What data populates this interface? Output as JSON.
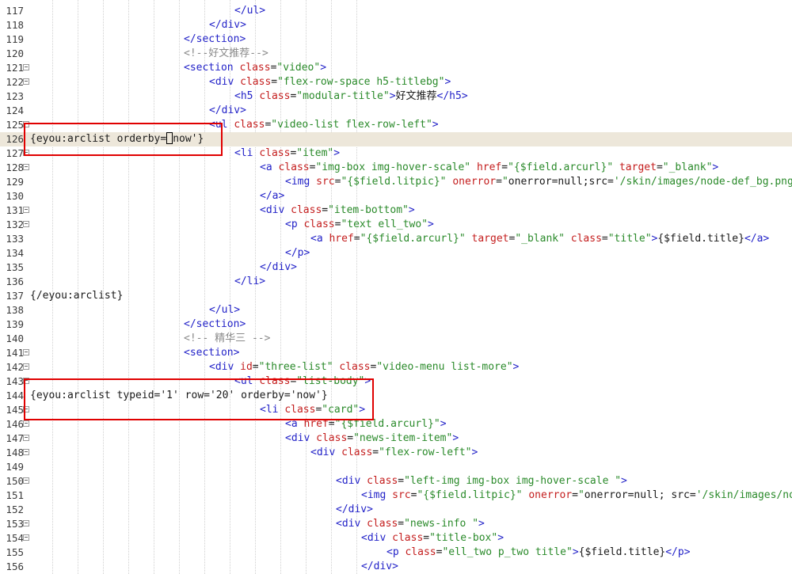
{
  "editor": {
    "guide_columns": [
      66,
      98,
      130,
      162,
      194,
      226,
      258,
      290,
      322,
      354,
      386,
      418,
      450
    ],
    "highlight_boxes": [
      {
        "label": "orderby-now-box"
      },
      {
        "label": "typeid-row-box"
      }
    ],
    "lines": [
      {
        "no": "117",
        "fold": false,
        "indent": 8,
        "tokens": [
          [
            "t",
            "</ul>"
          ]
        ]
      },
      {
        "no": "118",
        "fold": false,
        "indent": 7,
        "tokens": [
          [
            "t",
            "</div>"
          ]
        ]
      },
      {
        "no": "119",
        "fold": false,
        "indent": 6,
        "tokens": [
          [
            "t",
            "</section>"
          ]
        ]
      },
      {
        "no": "120",
        "fold": false,
        "indent": 6,
        "tokens": [
          [
            "c",
            "<!--好文推荐-->"
          ]
        ]
      },
      {
        "no": "121",
        "fold": true,
        "indent": 6,
        "tokens": [
          [
            "t",
            "<section "
          ],
          [
            "a",
            "class"
          ],
          [
            "x",
            "="
          ],
          [
            "s",
            "\"video\""
          ],
          [
            "t",
            ">"
          ]
        ]
      },
      {
        "no": "122",
        "fold": true,
        "indent": 7,
        "tokens": [
          [
            "t",
            "<div "
          ],
          [
            "a",
            "class"
          ],
          [
            "x",
            "="
          ],
          [
            "s",
            "\"flex-row-space h5-titlebg\""
          ],
          [
            "t",
            ">"
          ]
        ]
      },
      {
        "no": "123",
        "fold": false,
        "indent": 8,
        "tokens": [
          [
            "t",
            "<h5 "
          ],
          [
            "a",
            "class"
          ],
          [
            "x",
            "="
          ],
          [
            "s",
            "\"modular-title\""
          ],
          [
            "t",
            ">"
          ],
          [
            "x",
            "好文推荐"
          ],
          [
            "t",
            "</h5>"
          ]
        ]
      },
      {
        "no": "124",
        "fold": false,
        "indent": 7,
        "tokens": [
          [
            "t",
            "</div>"
          ]
        ]
      },
      {
        "no": "125",
        "fold": true,
        "indent": 7,
        "tokens": [
          [
            "t",
            "<ul "
          ],
          [
            "a",
            "class"
          ],
          [
            "x",
            "="
          ],
          [
            "s",
            "\"video-list flex-row-left\""
          ],
          [
            "t",
            ">"
          ]
        ]
      },
      {
        "no": "126",
        "fold": false,
        "indent": 0,
        "current": true,
        "tokens": [
          [
            "x",
            "{eyou:arclist orderby="
          ],
          [
            "caret",
            ""
          ],
          [
            "x",
            "now'}"
          ]
        ]
      },
      {
        "no": "127",
        "fold": true,
        "indent": 8,
        "tokens": [
          [
            "t",
            "<li "
          ],
          [
            "a",
            "class"
          ],
          [
            "x",
            "="
          ],
          [
            "s",
            "\"item\""
          ],
          [
            "t",
            ">"
          ]
        ]
      },
      {
        "no": "128",
        "fold": true,
        "indent": 9,
        "tokens": [
          [
            "t",
            "<a "
          ],
          [
            "a",
            "class"
          ],
          [
            "x",
            "="
          ],
          [
            "s",
            "\"img-box img-hover-scale\""
          ],
          [
            "x",
            " "
          ],
          [
            "a",
            "href"
          ],
          [
            "x",
            "="
          ],
          [
            "s",
            "\"{$field.arcurl}\""
          ],
          [
            "x",
            " "
          ],
          [
            "a",
            "target"
          ],
          [
            "x",
            "="
          ],
          [
            "s",
            "\"_blank\""
          ],
          [
            "t",
            ">"
          ]
        ]
      },
      {
        "no": "129",
        "fold": false,
        "indent": 10,
        "tokens": [
          [
            "t",
            "<img "
          ],
          [
            "a",
            "src"
          ],
          [
            "x",
            "="
          ],
          [
            "s",
            "\"{$field.litpic}\""
          ],
          [
            "x",
            " "
          ],
          [
            "a",
            "onerror"
          ],
          [
            "x",
            "="
          ],
          [
            "s",
            "\""
          ],
          [
            "x",
            "onerror=null;src="
          ],
          [
            "s",
            "'/skin/images/node-def_bg.png"
          ]
        ]
      },
      {
        "no": "130",
        "fold": false,
        "indent": 9,
        "tokens": [
          [
            "t",
            "</a>"
          ]
        ]
      },
      {
        "no": "131",
        "fold": true,
        "indent": 9,
        "tokens": [
          [
            "t",
            "<div "
          ],
          [
            "a",
            "class"
          ],
          [
            "x",
            "="
          ],
          [
            "s",
            "\"item-bottom\""
          ],
          [
            "t",
            ">"
          ]
        ]
      },
      {
        "no": "132",
        "fold": true,
        "indent": 10,
        "tokens": [
          [
            "t",
            "<p "
          ],
          [
            "a",
            "class"
          ],
          [
            "x",
            "="
          ],
          [
            "s",
            "\"text ell_two\""
          ],
          [
            "t",
            ">"
          ]
        ]
      },
      {
        "no": "133",
        "fold": false,
        "indent": 11,
        "tokens": [
          [
            "t",
            "<a "
          ],
          [
            "a",
            "href"
          ],
          [
            "x",
            "="
          ],
          [
            "s",
            "\"{$field.arcurl}\""
          ],
          [
            "x",
            " "
          ],
          [
            "a",
            "target"
          ],
          [
            "x",
            "="
          ],
          [
            "s",
            "\"_blank\""
          ],
          [
            "x",
            " "
          ],
          [
            "a",
            "class"
          ],
          [
            "x",
            "="
          ],
          [
            "s",
            "\"title\""
          ],
          [
            "t",
            ">"
          ],
          [
            "x",
            "{$field.title}"
          ],
          [
            "t",
            "</a>"
          ]
        ]
      },
      {
        "no": "134",
        "fold": false,
        "indent": 10,
        "tokens": [
          [
            "t",
            "</p>"
          ]
        ]
      },
      {
        "no": "135",
        "fold": false,
        "indent": 9,
        "tokens": [
          [
            "t",
            "</div>"
          ]
        ]
      },
      {
        "no": "136",
        "fold": false,
        "indent": 8,
        "tokens": [
          [
            "t",
            "</li>"
          ]
        ]
      },
      {
        "no": "137",
        "fold": false,
        "indent": 0,
        "tokens": [
          [
            "x",
            "{/eyou:arclist}"
          ]
        ]
      },
      {
        "no": "138",
        "fold": false,
        "indent": 7,
        "tokens": [
          [
            "t",
            "</ul>"
          ]
        ]
      },
      {
        "no": "139",
        "fold": false,
        "indent": 6,
        "tokens": [
          [
            "t",
            "</section>"
          ]
        ]
      },
      {
        "no": "140",
        "fold": false,
        "indent": 6,
        "tokens": [
          [
            "c",
            "<!-- 精华三 -->"
          ]
        ]
      },
      {
        "no": "141",
        "fold": true,
        "indent": 6,
        "tokens": [
          [
            "t",
            "<section>"
          ]
        ]
      },
      {
        "no": "142",
        "fold": true,
        "indent": 7,
        "tokens": [
          [
            "t",
            "<div "
          ],
          [
            "a",
            "id"
          ],
          [
            "x",
            "="
          ],
          [
            "s",
            "\"three-list\""
          ],
          [
            "x",
            " "
          ],
          [
            "a",
            "class"
          ],
          [
            "x",
            "="
          ],
          [
            "s",
            "\"video-menu list-more\""
          ],
          [
            "t",
            ">"
          ]
        ]
      },
      {
        "no": "143",
        "fold": true,
        "indent": 8,
        "tokens": [
          [
            "t",
            "<ul "
          ],
          [
            "a",
            "class"
          ],
          [
            "x",
            "="
          ],
          [
            "s",
            "\"list-body\""
          ],
          [
            "t",
            ">"
          ]
        ]
      },
      {
        "no": "144",
        "fold": false,
        "indent": 0,
        "tokens": [
          [
            "x",
            "{eyou:arclist typeid='1' row='20' orderby='now'}"
          ]
        ]
      },
      {
        "no": "145",
        "fold": true,
        "indent": 9,
        "tokens": [
          [
            "t",
            "<li "
          ],
          [
            "a",
            "class"
          ],
          [
            "x",
            "="
          ],
          [
            "s",
            "\"card\""
          ],
          [
            "t",
            ">"
          ]
        ]
      },
      {
        "no": "146",
        "fold": true,
        "indent": 10,
        "tokens": [
          [
            "t",
            "<a "
          ],
          [
            "a",
            "href"
          ],
          [
            "x",
            "="
          ],
          [
            "s",
            "\"{$field.arcurl}\""
          ],
          [
            "t",
            ">"
          ]
        ]
      },
      {
        "no": "147",
        "fold": true,
        "indent": 10,
        "tokens": [
          [
            "t",
            "<div "
          ],
          [
            "a",
            "class"
          ],
          [
            "x",
            "="
          ],
          [
            "s",
            "\"news-item-item\""
          ],
          [
            "t",
            ">"
          ]
        ]
      },
      {
        "no": "148",
        "fold": true,
        "indent": 11,
        "tokens": [
          [
            "t",
            "<div "
          ],
          [
            "a",
            "class"
          ],
          [
            "x",
            "="
          ],
          [
            "s",
            "\"flex-row-left\""
          ],
          [
            "t",
            ">"
          ]
        ]
      },
      {
        "no": "149",
        "fold": false,
        "indent": 0,
        "tokens": []
      },
      {
        "no": "150",
        "fold": true,
        "indent": 12,
        "tokens": [
          [
            "t",
            "<div "
          ],
          [
            "a",
            "class"
          ],
          [
            "x",
            "="
          ],
          [
            "s",
            "\"left-img img-box img-hover-scale \""
          ],
          [
            "t",
            ">"
          ]
        ]
      },
      {
        "no": "151",
        "fold": false,
        "indent": 13,
        "tokens": [
          [
            "t",
            "<img "
          ],
          [
            "a",
            "src"
          ],
          [
            "x",
            "="
          ],
          [
            "s",
            "\"{$field.litpic}\""
          ],
          [
            "x",
            " "
          ],
          [
            "a",
            "onerror"
          ],
          [
            "x",
            "="
          ],
          [
            "s",
            "\""
          ],
          [
            "x",
            "onerror=null; src="
          ],
          [
            "s",
            "'/skin/images/nod"
          ]
        ]
      },
      {
        "no": "152",
        "fold": false,
        "indent": 12,
        "tokens": [
          [
            "t",
            "</div>"
          ]
        ]
      },
      {
        "no": "153",
        "fold": true,
        "indent": 12,
        "tokens": [
          [
            "t",
            "<div "
          ],
          [
            "a",
            "class"
          ],
          [
            "x",
            "="
          ],
          [
            "s",
            "\"news-info \""
          ],
          [
            "t",
            ">"
          ]
        ]
      },
      {
        "no": "154",
        "fold": true,
        "indent": 13,
        "tokens": [
          [
            "t",
            "<div "
          ],
          [
            "a",
            "class"
          ],
          [
            "x",
            "="
          ],
          [
            "s",
            "\"title-box\""
          ],
          [
            "t",
            ">"
          ]
        ]
      },
      {
        "no": "155",
        "fold": false,
        "indent": 14,
        "tokens": [
          [
            "t",
            "<p "
          ],
          [
            "a",
            "class"
          ],
          [
            "x",
            "="
          ],
          [
            "s",
            "\"ell_two p_two title\""
          ],
          [
            "t",
            ">"
          ],
          [
            "x",
            "{$field.title}"
          ],
          [
            "t",
            "</p>"
          ]
        ]
      },
      {
        "no": "156",
        "fold": false,
        "indent": 13,
        "tokens": [
          [
            "t",
            "</div>"
          ]
        ]
      }
    ]
  }
}
